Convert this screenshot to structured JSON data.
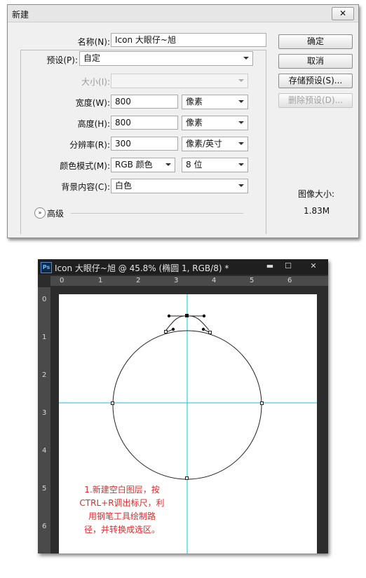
{
  "dialog": {
    "title": "新建",
    "close_label": "✕",
    "name_label": "名称(N):",
    "name_value": "Icon    大眼仔~旭",
    "preset_label": "预设(P):",
    "preset_value": "自定",
    "size_label": "大小(I):",
    "size_value": "",
    "width_label": "宽度(W):",
    "width_value": "800",
    "width_unit": "像素",
    "height_label": "高度(H):",
    "height_value": "800",
    "height_unit": "像素",
    "resolution_label": "分辨率(R):",
    "resolution_value": "300",
    "resolution_unit": "像素/英寸",
    "color_mode_label": "颜色模式(M):",
    "color_mode_value": "RGB 颜色",
    "bit_depth_value": "8 位",
    "background_label": "背景内容(C):",
    "background_value": "白色",
    "advanced_label": "高级",
    "advanced_icon": "»",
    "buttons": {
      "ok": "确定",
      "cancel": "取消",
      "save_preset": "存储预设(S)...",
      "delete_preset": "删除预设(D)..."
    },
    "image_size_label": "图像大小:",
    "image_size_value": "1.83M"
  },
  "ps_window": {
    "app_badge": "Ps",
    "title": "Icon    大眼仔~旭 @ 45.8% (椭圆 1, RGB/8) *",
    "window_buttons": [
      "▬",
      "☐",
      "✕"
    ],
    "ruler_h_numbers": [
      "0",
      "1",
      "2",
      "3",
      "4",
      "5",
      "6"
    ],
    "ruler_v_numbers": [
      "0",
      "1",
      "2",
      "3",
      "4",
      "5",
      "6"
    ]
  },
  "annotation": {
    "lines": [
      "1.新建空白图层，按",
      "CTRL+R调出标尺，利",
      "用钢笔工具绘制路",
      "径，并转换成选区。"
    ]
  },
  "colors": {
    "guide": "#00c8dc",
    "annotation": "#e02b2b",
    "ps_frame": "#2c2c2c"
  }
}
